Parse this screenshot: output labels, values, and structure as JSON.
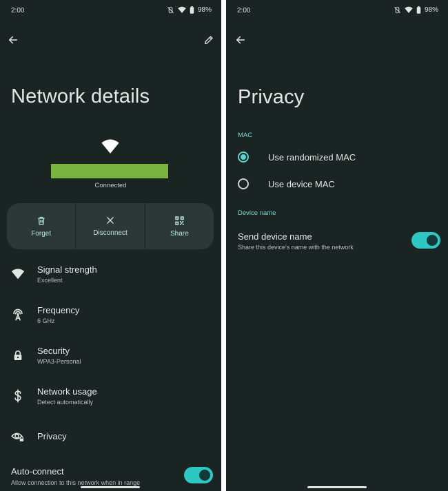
{
  "left": {
    "status": {
      "time": "2:00",
      "battery": "98%"
    },
    "title": "Network details",
    "connection_status": "Connected",
    "signal_level": 1.0,
    "actions": [
      {
        "label": "Forget",
        "icon": "trash-icon"
      },
      {
        "label": "Disconnect",
        "icon": "close-icon"
      },
      {
        "label": "Share",
        "icon": "qr-code-icon"
      }
    ],
    "details": [
      {
        "title": "Signal strength",
        "value": "Excellent",
        "icon": "wifi-icon"
      },
      {
        "title": "Frequency",
        "value": "6 GHz",
        "icon": "antenna-icon"
      },
      {
        "title": "Security",
        "value": "WPA3-Personal",
        "icon": "lock-icon"
      },
      {
        "title": "Network usage",
        "value": "Detect automatically",
        "icon": "dollar-icon"
      },
      {
        "title": "Privacy",
        "value": "",
        "icon": "privacy-eye-icon"
      }
    ],
    "auto_connect": {
      "title": "Auto-connect",
      "subtitle": "Allow connection to this network when in range",
      "enabled": true
    }
  },
  "right": {
    "status": {
      "time": "2:00",
      "battery": "98%"
    },
    "title": "Privacy",
    "mac_section": "MAC",
    "mac_options": [
      {
        "label": "Use randomized MAC",
        "selected": true
      },
      {
        "label": "Use device MAC",
        "selected": false
      }
    ],
    "device_name_section": "Device name",
    "send_device_name": {
      "title": "Send device name",
      "subtitle": "Share this device's name with the network",
      "enabled": true
    }
  },
  "colors": {
    "background": "#1a2423",
    "accent": "#2fc7c4",
    "signal_bar": "#7ab33f",
    "action_panel": "#2b3836",
    "section_label": "#7fd5d0"
  }
}
